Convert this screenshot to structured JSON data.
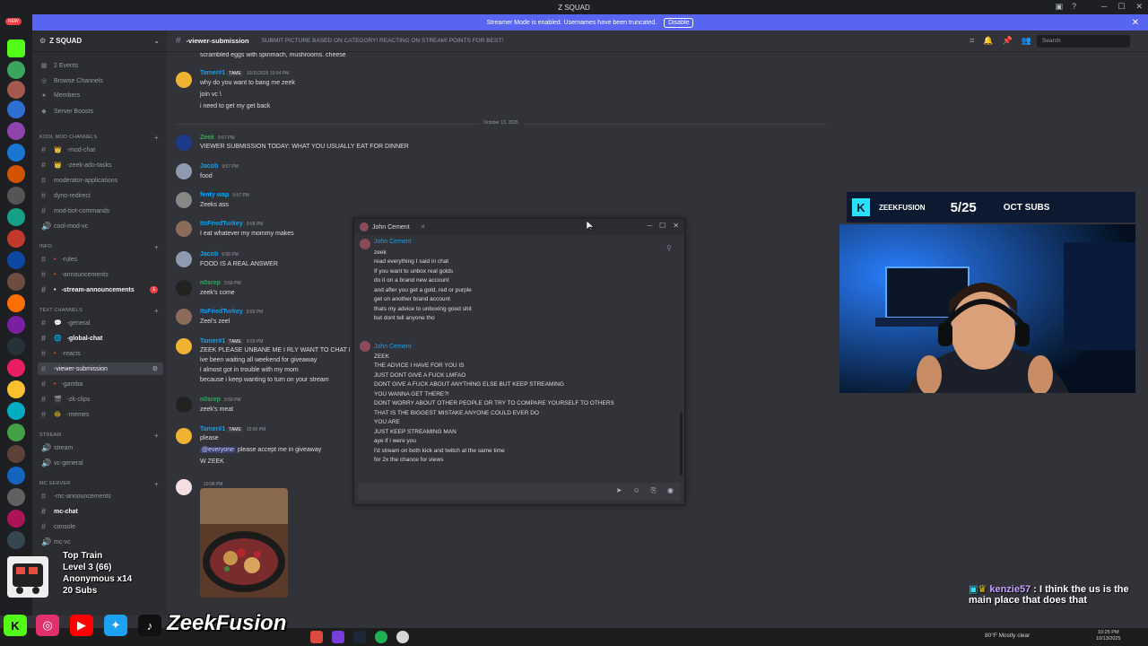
{
  "window": {
    "title": "Z SQUAD"
  },
  "banner": {
    "text": "Streamer Mode is enabled. Usernames have been truncated.",
    "button": "Disable"
  },
  "guilds": {
    "new_badge": "NEW"
  },
  "server": {
    "name": "Z SQUAD"
  },
  "sidebar": {
    "top_items": [
      {
        "icon": "calendar-icon",
        "label": "2 Events"
      },
      {
        "icon": "compass-icon",
        "label": "Browse Channels"
      },
      {
        "icon": "members-icon",
        "label": "Members"
      },
      {
        "icon": "boost-icon",
        "label": "Server Boosts"
      }
    ],
    "categories": [
      {
        "label": "Kool mod channels",
        "channels": [
          "-mod-chat",
          "-zeek-ado-tasks",
          "moderator-applications",
          "dyno-redirect",
          "mod-bot-commands",
          "cool-mod-vc"
        ]
      },
      {
        "label": "Info",
        "channels": [
          "-rules",
          "-announcements",
          "-stream-announcements"
        ]
      },
      {
        "label": "Text Channels",
        "channels": [
          "-general",
          "-global-chat",
          "-reacts",
          "-viewer-submission",
          "-gamba",
          "-zk-clips",
          "-memes"
        ]
      },
      {
        "label": "STREAM",
        "channels": [
          "stream",
          "vc-general"
        ]
      },
      {
        "label": "MC SERVER",
        "channels": [
          "-mc-announcements",
          "mc-chat",
          "console",
          "mc-vc"
        ]
      }
    ],
    "stream_announcements_badge": "1"
  },
  "header": {
    "channel": "-viewer-submission",
    "topic": "SUBMIT PICTURE BASED ON CATEGORY! REACTING ON STREAM! POINTS FOR BEST!",
    "search_placeholder": "Search"
  },
  "messages": [
    {
      "author": "",
      "lines": [
        "scrambled eggs with spinmach, mushrooms. cheese"
      ]
    },
    {
      "author": "Tamer#1",
      "tag": "TAME",
      "time": "10/11/2025 10:54 PM",
      "lines": [
        "why do you want to bang me zeek",
        "join vc \\",
        "i need to get my get back"
      ]
    },
    {
      "author": "Zeek",
      "time": "9:57 PM",
      "lines": [
        "VIEWER SUBMISSION TODAY: WHAT YOU USUALLY EAT FOR DINNER"
      ]
    },
    {
      "author": "Jacob",
      "time": "9:57 PM",
      "lines": [
        "food"
      ]
    },
    {
      "author": "fenty wap",
      "time": "9:57 PM",
      "lines": [
        "Zeeks ass"
      ]
    },
    {
      "author": "ItsFriedTurkey",
      "time": "9:58 PM",
      "lines": [
        "I eat whatever my mommy makes"
      ]
    },
    {
      "author": "Jacob",
      "time": "9:58 PM",
      "lines": [
        "FOOD IS A REAL ANSWER"
      ]
    },
    {
      "author": "n0srep",
      "time": "9:59 PM",
      "lines": [
        "zeek's come"
      ]
    },
    {
      "author": "ItsFriedTurkey",
      "time": "9:59 PM",
      "lines": [
        "Zeel's zeel"
      ]
    },
    {
      "author": "Tamer#1",
      "tag": "TAME",
      "time": "9:59 PM",
      "lines": [
        "ZEEK PLEASE UNBANE ME I RLY WANT TO CHAT I",
        "ive been waiting all weekend for giveaway",
        "i almost got in trouble with my mom",
        "because i keep wanting to turn on your stream"
      ]
    },
    {
      "author": "n0srep",
      "time": "9:59 PM",
      "lines": [
        "zeek's meat"
      ]
    },
    {
      "author": "Tamer#1",
      "tag": "TAME",
      "time": "10:00 PM",
      "lines": [
        "please",
        "please accept me in giveaway",
        "W ZEEK"
      ],
      "mention": "@everyone"
    },
    {
      "author": "",
      "time": "10:06 PM",
      "lines": []
    }
  ],
  "date_separator": "October 13, 2025",
  "popout": {
    "title": "John Cement",
    "msg1": {
      "author": "John Cement",
      "lines": [
        "zeek",
        "read everything I said in chat",
        "If you want to unbox real golds",
        "do it on a brand new account",
        "and after you get a gold, red or purple",
        "get on another brand account",
        "thats my advice to unboxing good shit",
        "but dont tell anyone tho"
      ]
    },
    "msg2": {
      "author": "John Cement",
      "lines": [
        "ZEEK",
        "THE ADVICE I HAVE FOR YOU IS",
        "JUST DONT GIVE A FUCK LMFAO",
        "DONT GIVE A FUCK ABOUT ANYTHING ELSE BUT KEEP STREAMING",
        "YOU WANNA GET THERE?!",
        "DONT WORRY ABOUT OTHER PEOPLE OR TRY TO COMPARE YOURSELF TO OTHERS",
        "THAT IS THE BIGGEST MISTAKE ANYONE COULD EVER DO",
        "YOU ARE",
        "JUST KEEP STREAMING MAN",
        "aye if i were you",
        "I'd stream on both kick and twitch at the same time",
        "for 2x the chance for views"
      ]
    }
  },
  "stream": {
    "brand": "ZEEKFUSION",
    "subs": "5/25",
    "subs_label": "OCT SUBS",
    "train_title": "Top Train",
    "train_level": "Level 3 (66)",
    "train_anon": "Anonymous x14",
    "train_subs": "20 Subs",
    "handle": "ZeekFusion",
    "chat_user": "kenzie57",
    "chat_text": "I think the us is the main place that does that"
  },
  "taskbar": {
    "weather": "80°F  Mostly clear",
    "time": "10:25 PM",
    "date": "10/13/2025"
  },
  "colors": {
    "accent": "#5865f2",
    "kick": "#53fc18",
    "youtube": "#ff0000",
    "instagram": "#e1306c",
    "twitter": "#1da1f2"
  }
}
